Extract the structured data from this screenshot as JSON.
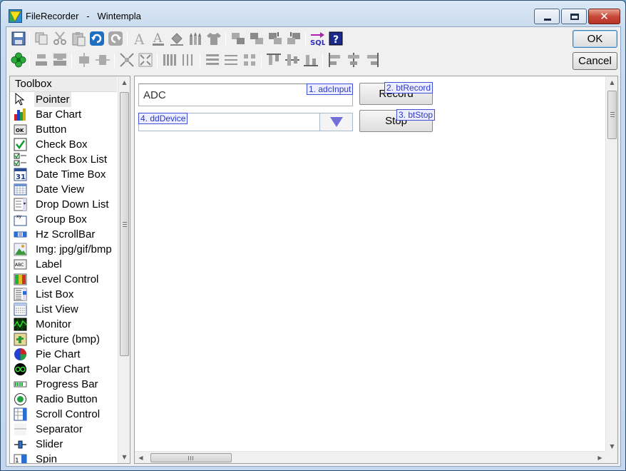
{
  "window": {
    "app_name": "FileRecorder",
    "separator": "-",
    "file_name": "Wintempla"
  },
  "dialog_buttons": {
    "ok": "OK",
    "cancel": "Cancel"
  },
  "toolbox": {
    "header": "Toolbox",
    "items": [
      {
        "label": "Pointer",
        "icon": "pointer-icon"
      },
      {
        "label": "Bar Chart",
        "icon": "bar-chart-icon"
      },
      {
        "label": "Button",
        "icon": "button-icon"
      },
      {
        "label": "Check Box",
        "icon": "check-box-icon"
      },
      {
        "label": "Check Box List",
        "icon": "check-box-list-icon"
      },
      {
        "label": "Date Time Box",
        "icon": "calendar-icon"
      },
      {
        "label": "Date View",
        "icon": "date-view-icon"
      },
      {
        "label": "Drop Down List",
        "icon": "drop-down-list-icon"
      },
      {
        "label": "Group Box",
        "icon": "group-box-icon"
      },
      {
        "label": "Hz ScrollBar",
        "icon": "hz-scrollbar-icon"
      },
      {
        "label": "Img: jpg/gif/bmp",
        "icon": "image-icon"
      },
      {
        "label": "Label",
        "icon": "label-icon"
      },
      {
        "label": "Level Control",
        "icon": "level-control-icon"
      },
      {
        "label": "List Box",
        "icon": "list-box-icon"
      },
      {
        "label": "List View",
        "icon": "list-view-icon"
      },
      {
        "label": "Monitor",
        "icon": "monitor-icon"
      },
      {
        "label": "Picture (bmp)",
        "icon": "picture-icon"
      },
      {
        "label": "Pie Chart",
        "icon": "pie-chart-icon"
      },
      {
        "label": "Polar Chart",
        "icon": "polar-chart-icon"
      },
      {
        "label": "Progress Bar",
        "icon": "progress-bar-icon"
      },
      {
        "label": "Radio Button",
        "icon": "radio-button-icon"
      },
      {
        "label": "Scroll Control",
        "icon": "scroll-control-icon"
      },
      {
        "label": "Separator",
        "icon": "separator-icon"
      },
      {
        "label": "Slider",
        "icon": "slider-icon"
      },
      {
        "label": "Spin",
        "icon": "spin-icon"
      }
    ],
    "selected": "Pointer"
  },
  "canvas": {
    "adc_input": {
      "value": "ADC",
      "tag": "1. adcInput"
    },
    "bt_record": {
      "label": "Record",
      "tag": "2. btRecord"
    },
    "bt_stop": {
      "label": "Stop",
      "tag": "3. btStop"
    },
    "dd_device": {
      "value": "",
      "tag": "4. ddDevice"
    }
  },
  "colors": {
    "title_gradient": "#c9dbee",
    "tag_text": "#2b37c8",
    "tag_border": "#4050d8",
    "close_button": "#c8493a"
  }
}
